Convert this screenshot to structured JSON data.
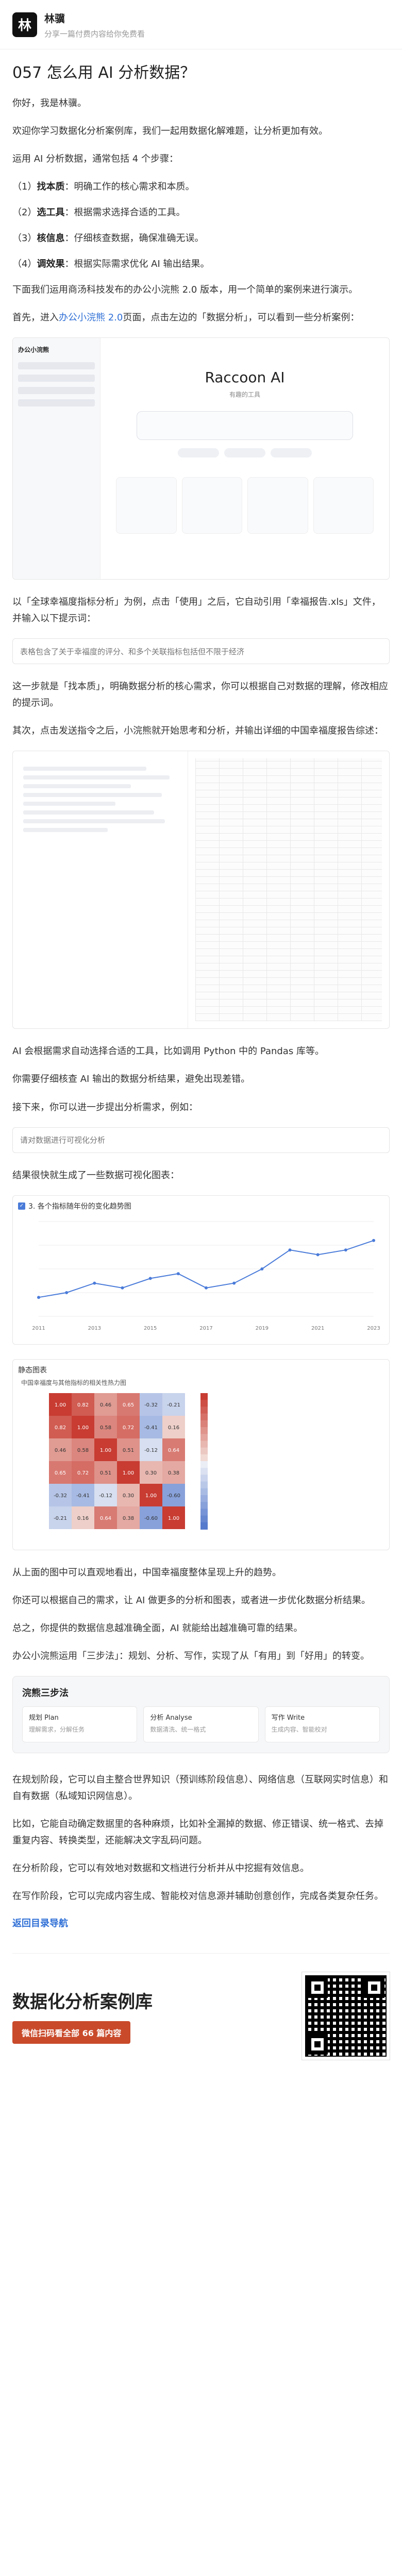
{
  "header": {
    "avatar_text": "林",
    "author": "林骥",
    "desc": "分享一篇付费内容给你免费看"
  },
  "title": "057 怎么用 AI 分析数据？",
  "intro": {
    "p1": "你好，我是林骥。",
    "p2": "欢迎你学习数据化分析案例库，我们一起用数据化解难题，让分析更加有效。",
    "p3": "运用 AI 分析数据，通常包括 4 个步骤："
  },
  "steps": [
    {
      "num": "（1）",
      "name": "找本质",
      "desc": "：明确工作的核心需求和本质。"
    },
    {
      "num": "（2）",
      "name": "选工具",
      "desc": "：根据需求选择合适的工具。"
    },
    {
      "num": "（3）",
      "name": "核信息",
      "desc": "：仔细核查数据，确保准确无误。"
    },
    {
      "num": "（4）",
      "name": "调效果",
      "desc": "：根据实际需求优化 AI 输出结果。"
    }
  ],
  "para": {
    "p4": "下面我们运用商汤科技发布的办公小浣熊 2.0 版本，用一个简单的案例来进行演示。",
    "p5_a": "首先，进入",
    "p5_link": "办公小浣熊 2.0",
    "p5_b": "页面，点击左边的「数据分析」，可以看到一些分析案例：",
    "p6": "以「全球幸福度指标分析」为例，点击「使用」之后，它自动引用「幸福报告.xls」文件，并输入以下提示词：",
    "prompt1": "表格包含了关于幸福度的评分、和多个关联指标包括但不限于经济",
    "p7": "这一步就是「找本质」，明确数据分析的核心需求，你可以根据自己对数据的理解，修改相应的提示词。",
    "p8": "其次，点击发送指令之后，小浣熊就开始思考和分析，并输出详细的中国幸福度报告综述：",
    "p9": "AI 会根据需求自动选择合适的工具，比如调用 Python 中的 Pandas 库等。",
    "p10": "你需要仔细核查 AI 输出的数据分析结果，避免出现差错。",
    "p11": "接下来，你可以进一步提出分析需求，例如：",
    "prompt2": "请对数据进行可视化分析",
    "p12": "结果很快就生成了一些数据可视化图表：",
    "p13": "从上面的图中可以直观地看出，中国幸福度整体呈现上升的趋势。",
    "p14": "你还可以根据自己的需求，让 AI 做更多的分析和图表，或者进一步优化数据分析结果。",
    "p15": "总之，你提供的数据信息越准确全面，AI 就能给出越准确可靠的结果。",
    "p16": "办公小浣熊运用「三步法」：规划、分析、写作，实现了从「有用」到「好用」的转变。",
    "p17": "在规划阶段，它可以自主整合世界知识（预训练阶段信息）、网络信息（互联网实时信息）和自有数据（私域知识网信息）。",
    "p18": "比如，它能自动确定数据里的各种麻烦，比如补全漏掉的数据、修正错误、统一格式、去掉重复内容、转换类型，还能解决文字乱码问题。",
    "p19": "在分析阶段，它可以有效地对数据和文档进行分析并从中挖掘有效信息。",
    "p20": "在写作阶段，它可以完成内容生成、智能校对信息源并辅助创意创作，完成各类复杂任务。"
  },
  "shot1": {
    "logo": "办公小浣熊",
    "title": "Raccoon AI",
    "sub": "有趣的工具"
  },
  "line_chart": {
    "head": "3. 各个指标随年份的变化趋势图"
  },
  "heatmap": {
    "head": "静态图表",
    "title": "中国幸福度与其他指标的相关性热力图"
  },
  "three_steps": {
    "title": "浣熊三步法",
    "items": [
      {
        "name": "规划 Plan",
        "desc": "理解需求，分解任务"
      },
      {
        "name": "分析 Analyse",
        "desc": "数据清洗、统一格式"
      },
      {
        "name": "写作 Write",
        "desc": "生成内容、智能校对"
      }
    ]
  },
  "back_link": "返回目录导航",
  "footer": {
    "title": "数据化分析案例库",
    "badge": "微信扫码看全部 66 篇内容"
  },
  "chart_data": [
    {
      "type": "line",
      "title": "3. 各个指标随年份的变化趋势图",
      "x": [
        "2011",
        "2012",
        "2013",
        "2014",
        "2015",
        "2016",
        "2017",
        "2018",
        "2019",
        "2020",
        "2021",
        "2022",
        "2023"
      ],
      "series": [
        {
          "values": [
            4.9,
            5.0,
            5.2,
            5.1,
            5.3,
            5.4,
            5.1,
            5.2,
            5.5,
            5.9,
            5.8,
            5.9,
            6.1
          ]
        }
      ],
      "ylim": [
        4.5,
        6.5
      ]
    },
    {
      "type": "heatmap",
      "title": "中国幸福度与其他指标的相关性热力图",
      "values": [
        [
          1.0,
          0.82,
          0.46,
          0.65,
          -0.32,
          -0.21
        ],
        [
          0.82,
          1.0,
          0.58,
          0.72,
          -0.41,
          0.16
        ],
        [
          0.46,
          0.58,
          1.0,
          0.51,
          -0.12,
          0.64
        ],
        [
          0.65,
          0.72,
          0.51,
          1.0,
          0.3,
          0.38
        ],
        [
          -0.32,
          -0.41,
          -0.12,
          0.3,
          1.0,
          -0.6
        ],
        [
          -0.21,
          0.16,
          0.64,
          0.38,
          -0.6,
          1.0
        ]
      ]
    }
  ]
}
